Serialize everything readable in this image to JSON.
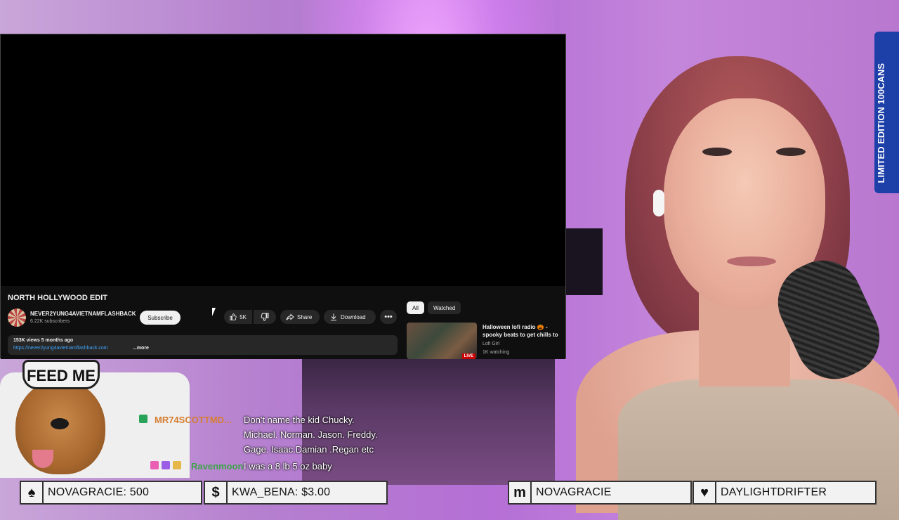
{
  "youtube": {
    "video_title": "NORTH HOLLYWOOD EDIT",
    "channel_name": "NEVER2YUNG4AVIETNAMFLASHBACK",
    "subscribers": "6.22K subscribers",
    "subscribe_label": "Subscribe",
    "like_count": "5K",
    "share_label": "Share",
    "download_label": "Download",
    "more_actions": "•••",
    "description_meta": "153K views  5 months ago",
    "description_link": "https://never2yung4avietnamflashback.com",
    "description_more": "...more",
    "chips": [
      "All",
      "Watched"
    ],
    "recommendation": {
      "title": "Halloween lofi radio 🎃 - spooky beats to get chills to",
      "channel": "Lofi Girl",
      "watching": "1K watching",
      "badge": "LIVE"
    }
  },
  "overlay": {
    "feed_me": "FEED ME",
    "can_text": "LIMITED EDITION 100CANS"
  },
  "chat": [
    {
      "user": "MR74SCOTTMD...",
      "lines": [
        "Don't name the kid Chucky.",
        "Michael. Norman. Jason. Freddy.",
        "Gage. Isaac.Damian .Regan etc"
      ]
    },
    {
      "user": "Ravenmoon",
      "lines": [
        "I was a 8 lb 5 oz baby"
      ]
    }
  ],
  "bottom_bar": [
    {
      "icon": "♠",
      "icon_name": "spade-icon",
      "text": "NOVAGRACIE: 500"
    },
    {
      "icon": "$",
      "icon_name": "dollar-icon",
      "text": "KWA_BENA: $3.00"
    },
    {
      "icon": "m",
      "icon_name": "member-icon",
      "text": "NOVAGRACIE"
    },
    {
      "icon": "♥",
      "icon_name": "heart-icon",
      "text": "DAYLIGHTDRIFTER"
    }
  ],
  "colors": {
    "yt_bg": "#0f0f0f",
    "link": "#3ea6ff",
    "chat_user1": "#d67d2f",
    "chat_user2": "#3fa24b"
  }
}
